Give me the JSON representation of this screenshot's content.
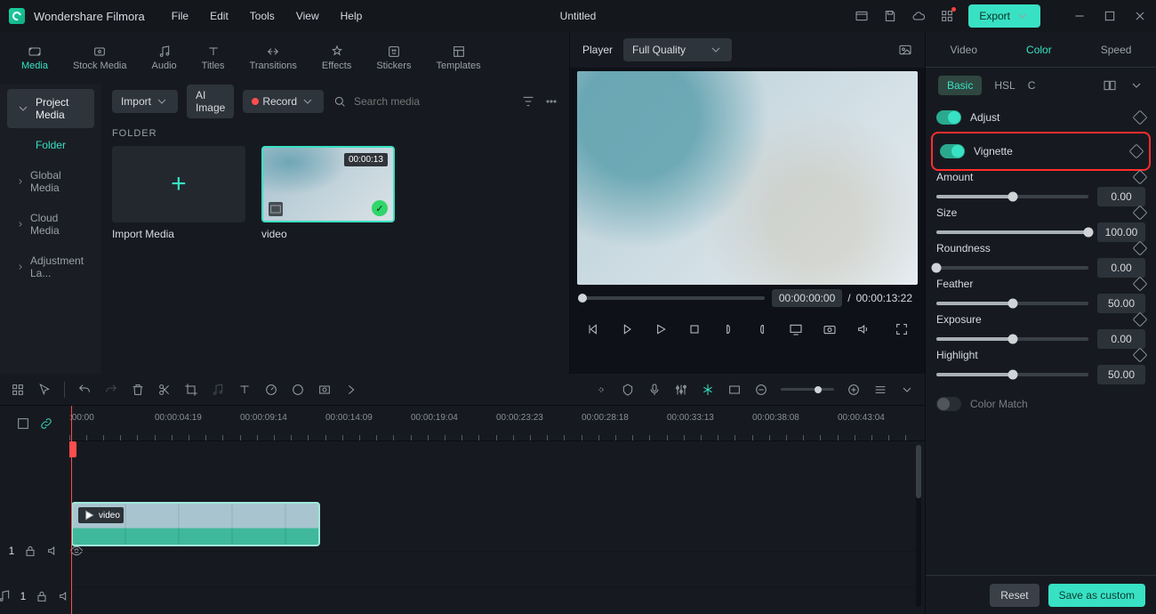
{
  "app": {
    "name": "Wondershare Filmora",
    "doc_title": "Untitled"
  },
  "menubar": [
    "File",
    "Edit",
    "Tools",
    "View",
    "Help"
  ],
  "export_label": "Export",
  "asset_tabs": [
    {
      "label": "Media",
      "icon": "media",
      "active": true
    },
    {
      "label": "Stock Media",
      "icon": "stock",
      "active": false
    },
    {
      "label": "Audio",
      "icon": "audio",
      "active": false
    },
    {
      "label": "Titles",
      "icon": "titles",
      "active": false
    },
    {
      "label": "Transitions",
      "icon": "transitions",
      "active": false
    },
    {
      "label": "Effects",
      "icon": "effects",
      "active": false
    },
    {
      "label": "Stickers",
      "icon": "stickers",
      "active": false
    },
    {
      "label": "Templates",
      "icon": "templates",
      "active": false
    }
  ],
  "sidebar": {
    "items": [
      "Project Media",
      "Folder",
      "Global Media",
      "Cloud Media",
      "Adjustment La..."
    ]
  },
  "media_toolbar": {
    "import": "Import",
    "ai_image": "AI Image",
    "record": "Record",
    "search_placeholder": "Search media"
  },
  "folder_label": "FOLDER",
  "thumbs": {
    "import_label": "Import Media",
    "clip": {
      "name": "video",
      "duration": "00:00:13"
    }
  },
  "player": {
    "tab": "Player",
    "quality": "Full Quality",
    "current": "00:00:00:00",
    "sep": "/",
    "total": "00:00:13:22"
  },
  "ruler_ticks": [
    ":00:00",
    "00:00:04:19",
    "00:00:09:14",
    "00:00:14:09",
    "00:00:19:04",
    "00:00:23:23",
    "00:00:28:18",
    "00:00:33:13",
    "00:00:38:08",
    "00:00:43:04"
  ],
  "timeline_clip": {
    "name": "video"
  },
  "track_labels": {
    "video": "1",
    "audio": "1"
  },
  "right": {
    "tabs": [
      "Video",
      "Color",
      "Speed"
    ],
    "subtabs": {
      "basic": "Basic",
      "hsl": "HSL",
      "c": "C"
    },
    "adjust": "Adjust",
    "vignette": "Vignette",
    "color_match": "Color Match",
    "props": [
      {
        "name": "Amount",
        "value": "0.00",
        "pct": 50
      },
      {
        "name": "Size",
        "value": "100.00",
        "pct": 100
      },
      {
        "name": "Roundness",
        "value": "0.00",
        "pct": 0
      },
      {
        "name": "Feather",
        "value": "50.00",
        "pct": 50
      },
      {
        "name": "Exposure",
        "value": "0.00",
        "pct": 50
      },
      {
        "name": "Highlight",
        "value": "50.00",
        "pct": 50
      }
    ],
    "reset": "Reset",
    "save": "Save as custom"
  }
}
